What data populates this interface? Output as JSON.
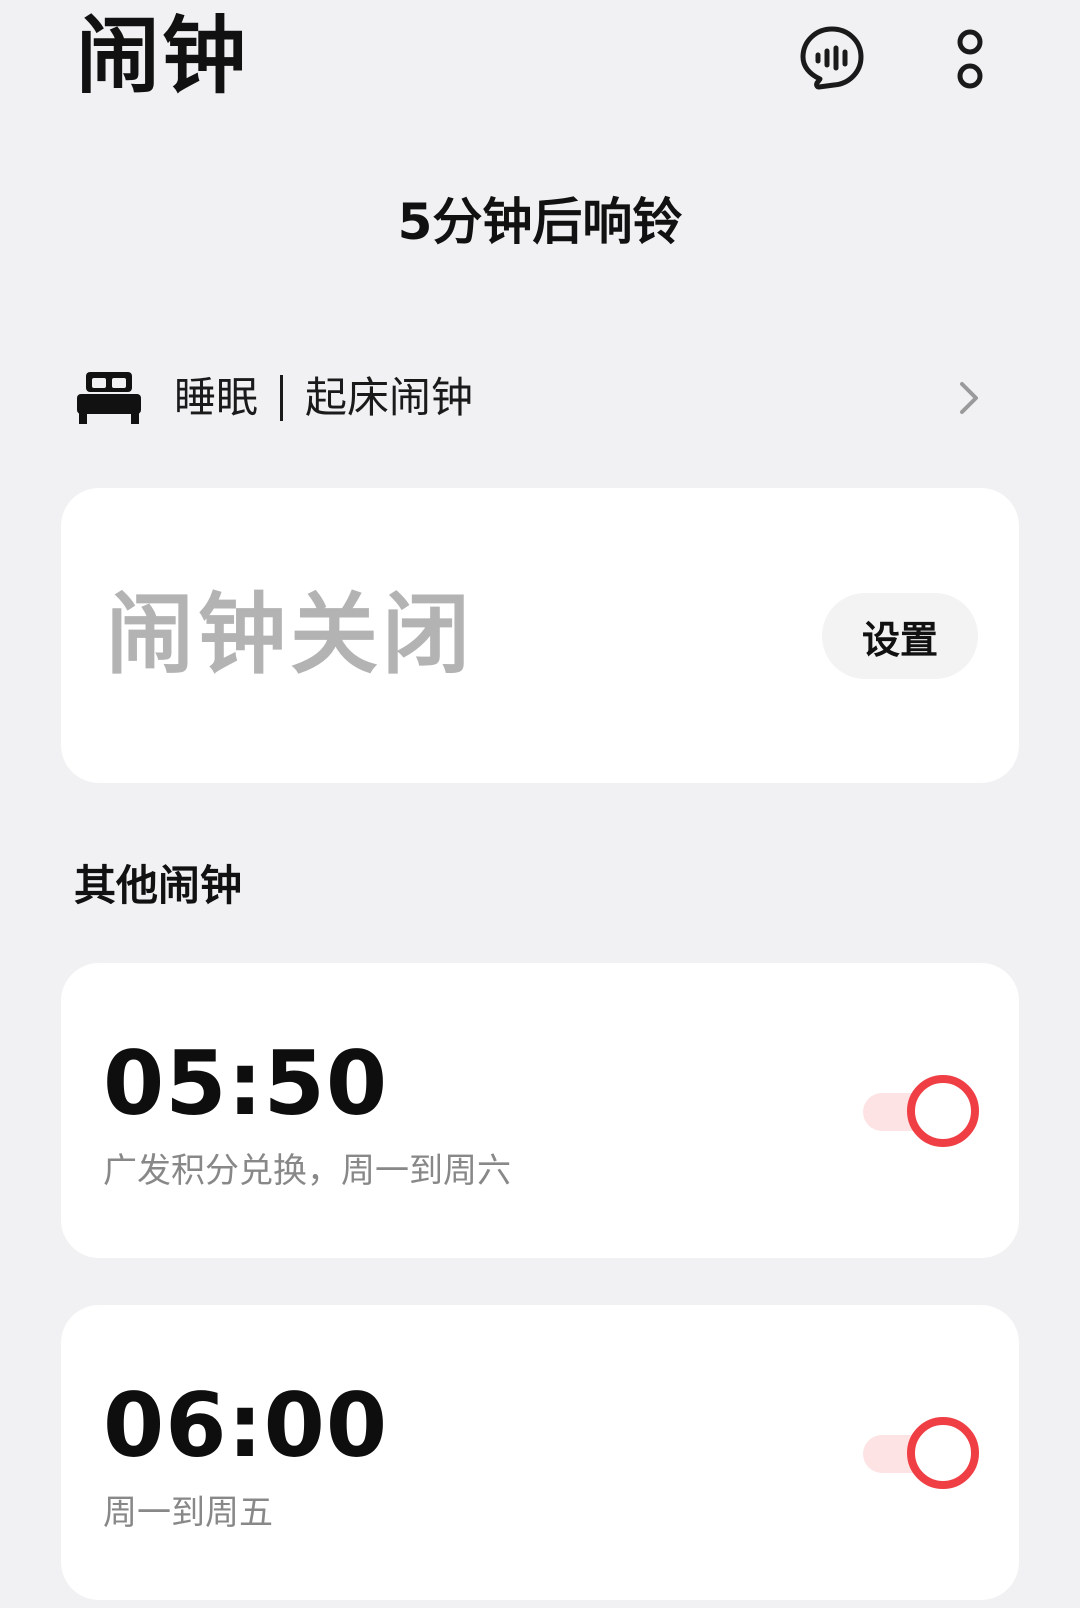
{
  "header": {
    "title": "闹钟",
    "voice_icon": "voice-assistant-icon",
    "more_icon": "more-vertical-icon"
  },
  "countdown": "5分钟后响铃",
  "sleep": {
    "icon": "bed-icon",
    "label_left": "睡眠",
    "label_right": "起床闹钟",
    "chevron": "chevron-right-icon"
  },
  "main_card": {
    "status": "闹钟关闭",
    "settings_label": "设置"
  },
  "other_alarms": {
    "title": "其他闹钟",
    "items": [
      {
        "time": "05:50",
        "description": "广发积分兑换，周一到周六",
        "enabled": true
      },
      {
        "time": "06:00",
        "description": "周一到周五",
        "enabled": true
      }
    ]
  },
  "colors": {
    "background": "#f1f1f3",
    "card": "#ffffff",
    "accent": "#ef3f45",
    "toggle_track": "#fde3e3",
    "muted_text": "#888888",
    "disabled_text": "#b3b3b3"
  }
}
